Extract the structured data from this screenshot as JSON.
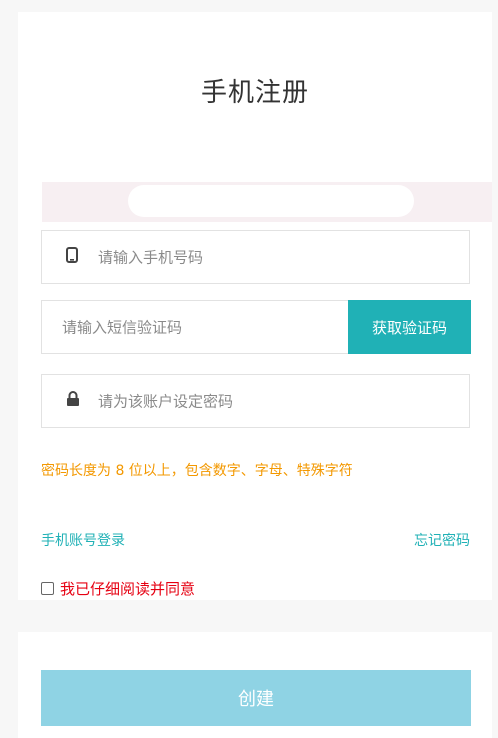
{
  "title": "手机注册",
  "phone": {
    "placeholder": "请输入手机号码",
    "icon": "phone-icon"
  },
  "sms": {
    "placeholder": "请输入短信验证码",
    "button": "获取验证码"
  },
  "password": {
    "placeholder": "请为该账户设定密码",
    "icon": "lock-icon"
  },
  "hint": "密码长度为 8 位以上，包含数字、字母、特殊字符",
  "links": {
    "phone_login": "手机账号登录",
    "forgot": "忘记密码"
  },
  "agree": {
    "label": "我已仔细阅读并同意",
    "checked": false
  },
  "submit": "创建",
  "colors": {
    "accent": "#20b1b6",
    "warning": "#f39800",
    "danger": "#e60012",
    "submit_bg": "#8fd3e4"
  }
}
